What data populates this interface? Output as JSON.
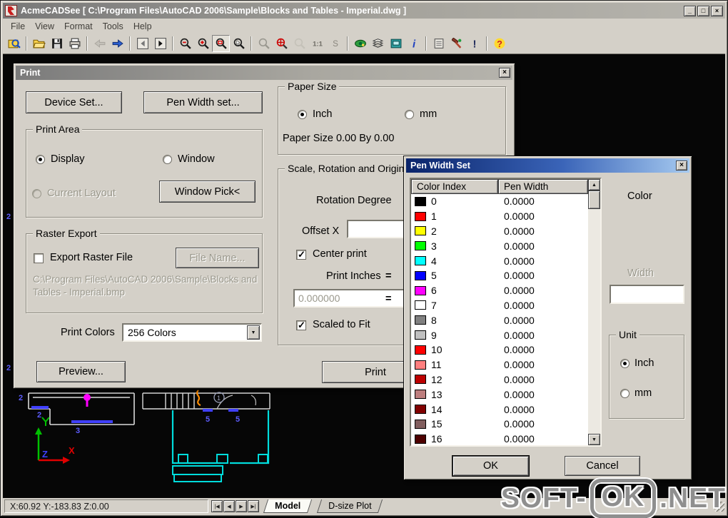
{
  "window": {
    "title": "AcmeCADSee [ C:\\Program Files\\AutoCAD 2006\\Sample\\Blocks and Tables - Imperial.dwg ]",
    "controls": {
      "minimize": "_",
      "maximize": "□",
      "close": "×"
    }
  },
  "menu": {
    "items": [
      "File",
      "View",
      "Format",
      "Tools",
      "Help"
    ]
  },
  "toolbar": {
    "items": [
      "preview",
      "sep",
      "open",
      "save",
      "print",
      "sep",
      "back",
      "forward",
      "sep",
      "page-prev",
      "page-next",
      "sep",
      "zoom-out",
      "zoom-in",
      "zoom-window",
      "zoom-drag",
      "sep",
      "zoom-prev",
      "zoom-extents",
      "zoom-scale",
      "one-to-one",
      "zoom-s",
      "sep",
      "eye",
      "layers",
      "panel",
      "info",
      "sep",
      "batch-print",
      "tools",
      "warning",
      "sep",
      "help"
    ],
    "pressed": "zoom-window",
    "disabled": [
      "back"
    ]
  },
  "print_dialog": {
    "title": "Print",
    "device_set": "Device Set...",
    "pen_width_set": "Pen Width set...",
    "print_area": {
      "legend": "Print Area",
      "display": "Display",
      "window": "Window",
      "current_layout": "Current Layout",
      "window_pick": "Window Pick<"
    },
    "paper_size": {
      "legend": "Paper Size",
      "inch": "Inch",
      "mm": "mm",
      "info": "Paper Size 0.00 By 0.00"
    },
    "scale": {
      "legend": "Scale, Rotation and Origin",
      "rotation_degree": "Rotation Degree",
      "offset_x": "Offset X",
      "center_print": "Center print",
      "print_inches": "Print Inches",
      "equals": "=",
      "value": "0.000000",
      "scaled_to_fit": "Scaled to Fit"
    },
    "raster": {
      "legend": "Raster Export",
      "export_label": "Export Raster File",
      "file_name": "File Name...",
      "path": "C:\\Program Files\\AutoCAD 2006\\Sample\\Blocks and Tables - Imperial.bmp"
    },
    "print_colors_label": "Print Colors",
    "print_colors_value": "256 Colors",
    "preview": "Preview...",
    "print": "Print"
  },
  "pen_dialog": {
    "title": "Pen Width Set",
    "columns": [
      "Color Index",
      "Pen Width"
    ],
    "rows": [
      {
        "index": "0",
        "color": "#000000",
        "width": "0.0000"
      },
      {
        "index": "1",
        "color": "#ff0000",
        "width": "0.0000"
      },
      {
        "index": "2",
        "color": "#ffff00",
        "width": "0.0000"
      },
      {
        "index": "3",
        "color": "#00ff00",
        "width": "0.0000"
      },
      {
        "index": "4",
        "color": "#00ffff",
        "width": "0.0000"
      },
      {
        "index": "5",
        "color": "#0000ff",
        "width": "0.0000"
      },
      {
        "index": "6",
        "color": "#ff00ff",
        "width": "0.0000"
      },
      {
        "index": "7",
        "color": "#ffffff",
        "width": "0.0000"
      },
      {
        "index": "8",
        "color": "#808080",
        "width": "0.0000"
      },
      {
        "index": "9",
        "color": "#c0c0c0",
        "width": "0.0000"
      },
      {
        "index": "10",
        "color": "#ff0000",
        "width": "0.0000"
      },
      {
        "index": "11",
        "color": "#ff7f7f",
        "width": "0.0000"
      },
      {
        "index": "12",
        "color": "#bd0000",
        "width": "0.0000"
      },
      {
        "index": "13",
        "color": "#bd7e7e",
        "width": "0.0000"
      },
      {
        "index": "14",
        "color": "#810000",
        "width": "0.0000"
      },
      {
        "index": "15",
        "color": "#815e5e",
        "width": "0.0000"
      },
      {
        "index": "16",
        "color": "#4d0000",
        "width": "0.0000"
      }
    ],
    "color_label": "Color",
    "width_label": "Width",
    "unit": {
      "legend": "Unit",
      "inch": "Inch",
      "mm": "mm"
    },
    "ok": "OK",
    "cancel": "Cancel"
  },
  "status_bar": {
    "coords": "X:60.92 Y:-183.83 Z:0.00",
    "nav": [
      "|◀",
      "◀",
      "▶",
      "▶|"
    ],
    "tabs": [
      "Model",
      "D-size Plot"
    ]
  },
  "watermark": {
    "part1": "SOFT-",
    "part2": "OK",
    "part3": ".NET"
  },
  "drawing": {
    "labels": {
      "x": "X",
      "z": "Z",
      "n1": "2",
      "n2": "2",
      "n3": "3",
      "n4": "5",
      "n5": "5",
      "circle": "1",
      "edge1": "2",
      "edge2": "2"
    }
  }
}
